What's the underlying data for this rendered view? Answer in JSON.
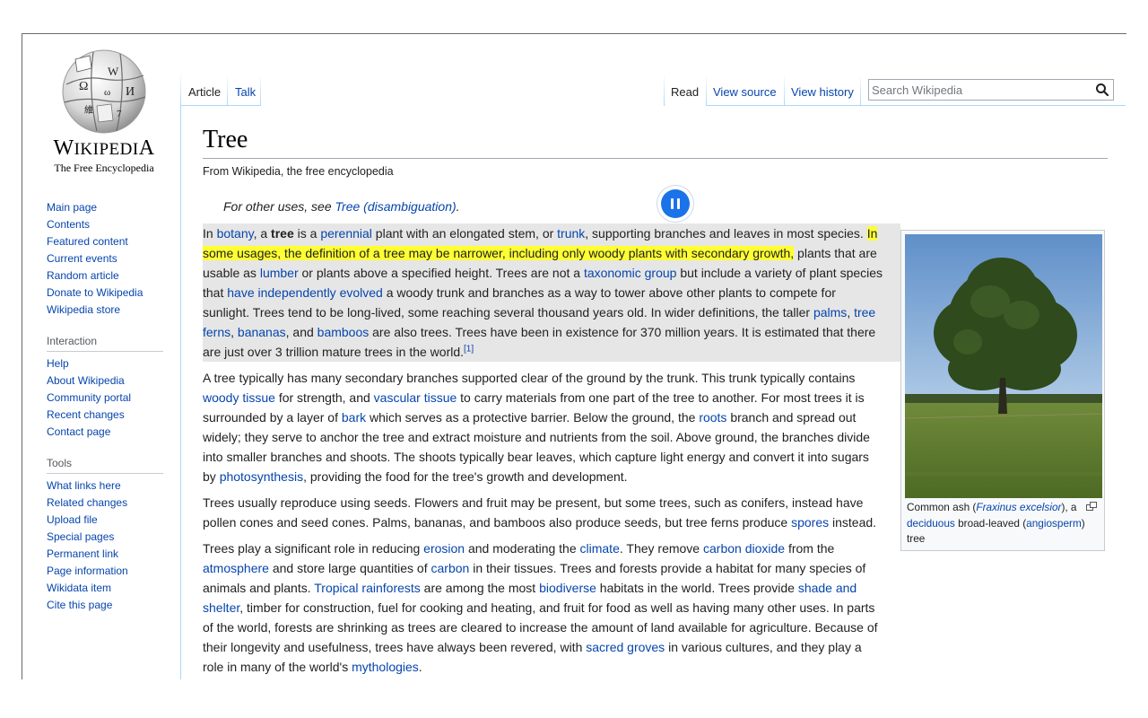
{
  "logo": {
    "wordmark_first": "W",
    "wordmark_rest": "IKIPEDI",
    "wordmark_last": "A",
    "tagline": "The Free Encyclopedia"
  },
  "sidebar": {
    "navigation": [
      "Main page",
      "Contents",
      "Featured content",
      "Current events",
      "Random article",
      "Donate to Wikipedia",
      "Wikipedia store"
    ],
    "interaction_heading": "Interaction",
    "interaction": [
      "Help",
      "About Wikipedia",
      "Community portal",
      "Recent changes",
      "Contact page"
    ],
    "tools_heading": "Tools",
    "tools": [
      "What links here",
      "Related changes",
      "Upload file",
      "Special pages",
      "Permanent link",
      "Page information",
      "Wikidata item",
      "Cite this page"
    ]
  },
  "tabs": {
    "article": "Article",
    "talk": "Talk",
    "read": "Read",
    "view_source": "View source",
    "view_history": "View history"
  },
  "search": {
    "placeholder": "Search Wikipedia"
  },
  "article": {
    "title": "Tree",
    "site_sub": "From Wikipedia, the free encyclopedia",
    "hatnote_prefix": "For other uses, see ",
    "hatnote_link": "Tree (disambiguation)",
    "hatnote_suffix": ".",
    "p1": {
      "t0": "In ",
      "l0": "botany",
      "t1": ", a ",
      "bold": "tree",
      "t2": " is a ",
      "l1": "perennial",
      "t3": " plant with an elongated stem, or ",
      "l2": "trunk",
      "t4": ", supporting branches and leaves in most species. ",
      "highlight": "In some usages, the definition of a tree may be narrower, including only woody plants with secondary growth,",
      "t5": " plants that are usable as ",
      "l3": "lumber",
      "t6": " or plants above a specified height. Trees are not a ",
      "l4": "taxonomic group",
      "t7": " but include a variety of plant species that ",
      "l5": "have independently evolved",
      "t8": " a woody trunk and branches as a way to tower above other plants to compete for sunlight. Trees tend to be long-lived, some reaching several thousand years old. In wider definitions, the taller ",
      "l6": "palms",
      "t9": ", ",
      "l7": "tree ferns",
      "t10": ", ",
      "l8": "bananas",
      "t11": ", and ",
      "l9": "bamboos",
      "t12": " are also trees. Trees have been in existence for 370 million years. It is estimated that there are just over 3 trillion mature trees in the world.",
      "ref": "[1]"
    },
    "p2": {
      "t0": "A tree typically has many secondary branches supported clear of the ground by the trunk. This trunk typically contains ",
      "l0": "woody tissue",
      "t1": " for strength, and ",
      "l1": "vascular tissue",
      "t2": " to carry materials from one part of the tree to another. For most trees it is surrounded by a layer of ",
      "l2": "bark",
      "t3": " which serves as a protective barrier. Below the ground, the ",
      "l3": "roots",
      "t4": " branch and spread out widely; they serve to anchor the tree and extract moisture and nutrients from the soil. Above ground, the branches divide into smaller branches and shoots. The shoots typically bear leaves, which capture light energy and convert it into sugars by ",
      "l4": "photosynthesis",
      "t5": ", providing the food for the tree's growth and development."
    },
    "p3": {
      "t0": "Trees usually reproduce using seeds. Flowers and fruit may be present, but some trees, such as conifers, instead have pollen cones and seed cones. Palms, bananas, and bamboos also produce seeds, but tree ferns produce ",
      "l0": "spores",
      "t1": " instead."
    },
    "p4": {
      "t0": "Trees play a significant role in reducing ",
      "l0": "erosion",
      "t1": " and moderating the ",
      "l1": "climate",
      "t2": ". They remove ",
      "l2": "carbon dioxide",
      "t3": " from the ",
      "l3": "atmosphere",
      "t4": " and store large quantities of ",
      "l4": "carbon",
      "t5": " in their tissues. Trees and forests provide a habitat for many species of animals and plants. ",
      "l5": "Tropical rainforests",
      "t6": " are among the most ",
      "l6": "biodiverse",
      "t7": " habitats in the world. Trees provide ",
      "l7": "shade and shelter",
      "t8": ", timber for construction, fuel for cooking and heating, and fruit for food as well as having many other uses. In parts of the world, forests are shrinking as trees are cleared to increase the amount of land available for agriculture. Because of their longevity and usefulness, trees have always been revered, with ",
      "l8": "sacred groves",
      "t9": " in various cultures, and they play a role in many of the world's ",
      "l9": "mythologies",
      "t10": "."
    },
    "caption": {
      "t0": "Common ash (",
      "l0": "Fraxinus excelsior",
      "t1": "), a ",
      "l1": "deciduous",
      "t2": " broad-leaved (",
      "l2": "angiosperm",
      "t3": ") tree"
    }
  },
  "colors": {
    "link": "#0645ad",
    "highlight": "#ffff33",
    "selection_bg": "#e6e6e6",
    "pause_button": "#1a73e8"
  },
  "icons": {
    "search": "magnifier-icon",
    "pause": "pause-icon",
    "enlarge": "enlarge-icon"
  }
}
